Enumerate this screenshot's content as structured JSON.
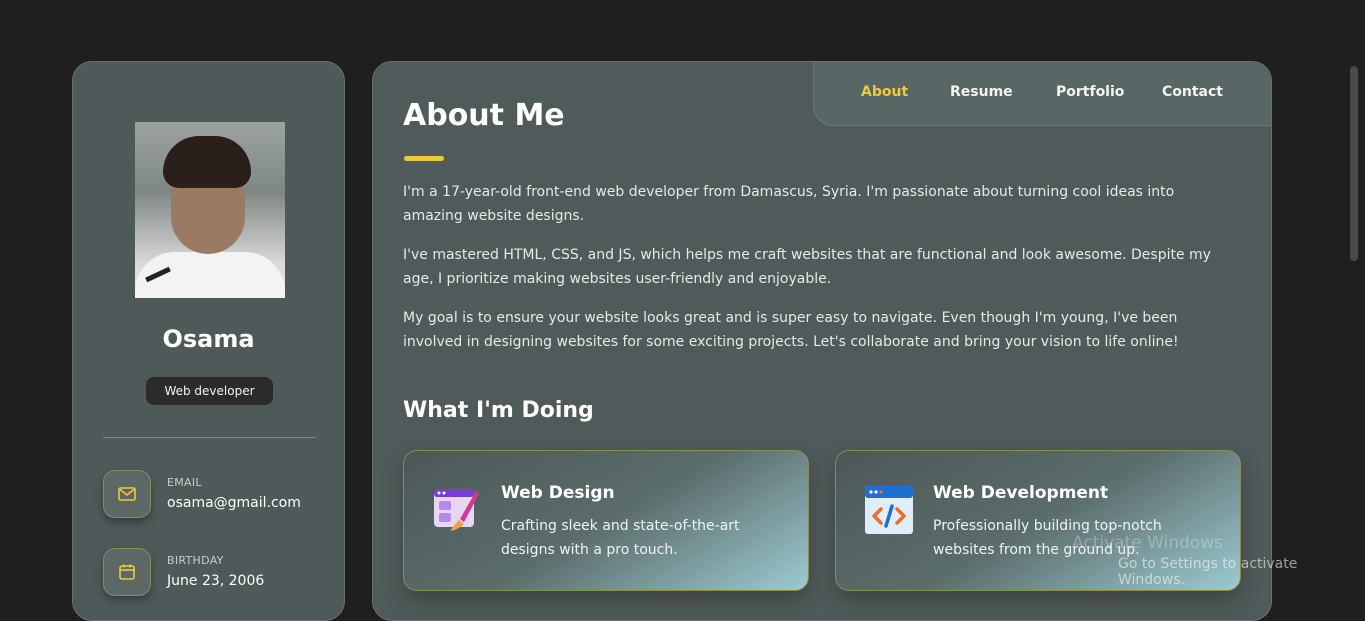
{
  "sidebar": {
    "name": "Osama",
    "role": "Web developer",
    "contacts": [
      {
        "label": "EMAIL",
        "value": "osama@gmail.com",
        "icon": "mail-icon"
      },
      {
        "label": "BIRTHDAY",
        "value": "June 23, 2006",
        "icon": "calendar-icon"
      }
    ]
  },
  "nav": {
    "items": [
      "About",
      "Resume",
      "Portfolio",
      "Contact"
    ],
    "active": "About"
  },
  "about": {
    "title": "About Me",
    "paragraphs": [
      "I'm a 17-year-old front-end web developer from Damascus, Syria. I'm passionate about turning cool ideas into amazing website designs.",
      "I've mastered HTML, CSS, and JS, which helps me craft websites that are functional and look awesome. Despite my age, I prioritize making websites user-friendly and enjoyable.",
      "My goal is to ensure your website looks great and is super easy to navigate. Even though I'm young, I've been involved in designing websites for some exciting projects. Let's collaborate and bring your vision to life online!"
    ]
  },
  "services": {
    "title": "What I'm Doing",
    "items": [
      {
        "title": "Web Design",
        "text": "Crafting sleek and state-of-the-art designs with a pro touch.",
        "icon": "design-icon"
      },
      {
        "title": "Web Development",
        "text": "Professionally building top-notch websites from the ground up.",
        "icon": "code-icon"
      }
    ]
  },
  "watermark": {
    "line1": "Activate Windows",
    "line2": "Go to Settings to activate Windows."
  },
  "colors": {
    "accent": "#f0c93b",
    "card": "#4f5b5a",
    "background": "#1f1f1f"
  }
}
